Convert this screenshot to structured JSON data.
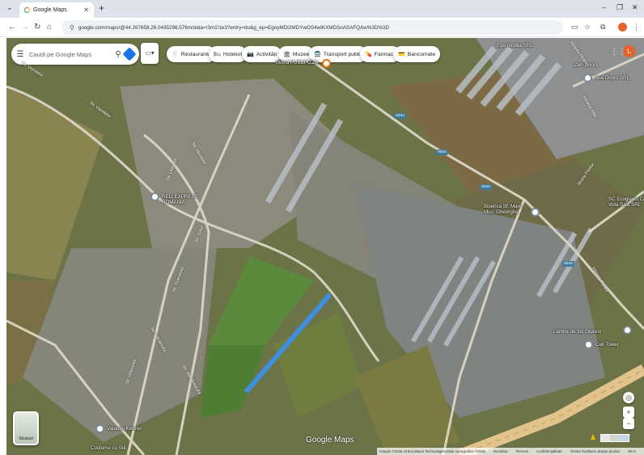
{
  "browser": {
    "tab_title": "Google Maps",
    "url": "google.com/maps/@44.267658,26.0435296,576m/data=!3m1!1e3?entry=ttu&g_ep=EgoyMDI2MDYwOS4wIKXMDSoASAFQAw%3D%3D",
    "new_tab": "+",
    "win_min": "–",
    "win_max": "❐",
    "win_close": "✕"
  },
  "search": {
    "placeholder": "Caută pe Google Maps"
  },
  "chips": [
    {
      "icon": "🍴",
      "label": "Restaurante"
    },
    {
      "icon": "🛏",
      "label": "Hoteluri"
    },
    {
      "icon": "📷",
      "label": "Activități"
    },
    {
      "icon": "🏛",
      "label": "Muzee"
    },
    {
      "icon": "🚍",
      "label": "Transport public"
    },
    {
      "icon": "💊",
      "label": "Farmacii"
    },
    {
      "icon": "💳",
      "label": "Bancomate"
    }
  ],
  "profile": {
    "initial": "L"
  },
  "places": {
    "ege_mobila": "Ege mobila SRL",
    "zen_doors": "Zen Doors",
    "aria_doors": "Aria Doors SRL",
    "pub": "Mitică PUB&PIZZA",
    "reli_express": "RELI EXPRESS\nROMANIA",
    "biserica": "Biserica Sf. Mare\nMuc. Gheorghe",
    "ecogreen": "SC Ecogreen Ca\nVida Sale SRL",
    "lemne": "Lemne de foc Giurest",
    "cell_tower": "Cell Tower",
    "costume": "Costume cu Stil",
    "valahus": "Valahus Kennel"
  },
  "streets": {
    "s1": "Str. Viorelelor",
    "s2": "Str. Viorelelor",
    "s3": "Str. Viorelelor",
    "s4": "Str. Liliacului",
    "s5": "Str. Teilor",
    "s6": "Str. Tineretului",
    "s7": "Str. Ghioceilor",
    "s8": "Str. Mărgăritarului",
    "s9": "Str. Salcâmului",
    "s10": "Intrarea Floarei",
    "s11": "Intrarea Ariei",
    "s12": "Strada Florilor",
    "s13": "Intrarea Florilor"
  },
  "road_labels": {
    "r1": "403A",
    "r2": "403A",
    "r3": "403A",
    "r4": "403A"
  },
  "map_controls": {
    "layer_label": "Straturi",
    "zoom_in": "+",
    "zoom_out": "−",
    "compass": "◎",
    "expand": "⌃"
  },
  "branding": "Google Maps",
  "attribution": {
    "imagery": "Imagini ©2026 Airbus,Maxar Technologies,Date cartografice ©2026",
    "country": "România",
    "terms": "Termeni",
    "privacy": "Confidențialitate",
    "feedback": "Trimite feedback despre produs",
    "scale": "50 m"
  },
  "colors": {
    "path": "#3f8fe0",
    "road": "#d7d2c0",
    "highway": "#e3c38c"
  }
}
